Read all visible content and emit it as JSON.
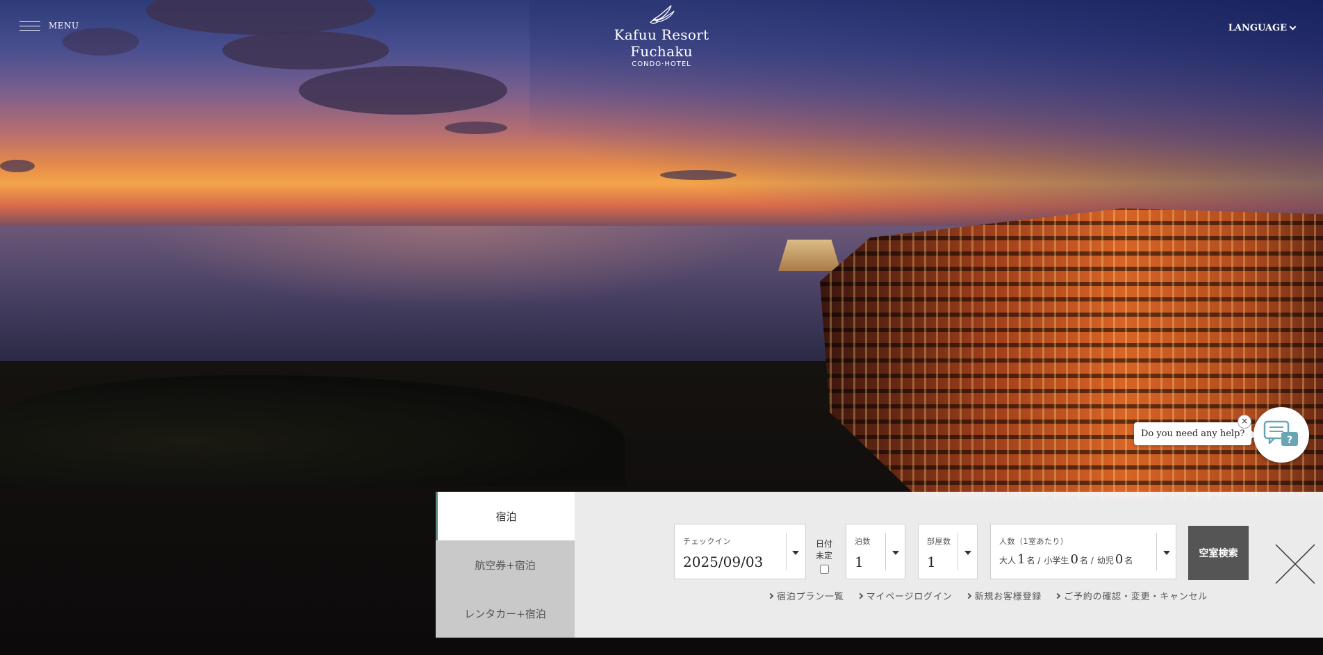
{
  "header": {
    "menu_label": "MENU",
    "logo_name": "Kafuu Resort Fuchaku",
    "logo_sub": "CONDO·HOTEL",
    "language_label": "LANGUAGE"
  },
  "chat": {
    "prompt": "Do you need any help?",
    "close_glyph": "×"
  },
  "booking": {
    "tabs": [
      {
        "label": "宿泊",
        "active": true
      },
      {
        "label": "航空券+宿泊",
        "active": false
      },
      {
        "label": "レンタカー+宿泊",
        "active": false
      }
    ],
    "checkin": {
      "label": "チェックイン",
      "value": "2025/09/03"
    },
    "undecided": {
      "line1": "日付",
      "line2": "未定",
      "checked": false
    },
    "nights": {
      "label": "泊数",
      "value": "1"
    },
    "rooms": {
      "label": "部屋数",
      "value": "1"
    },
    "people": {
      "label": "人数（1室あたり）",
      "adult_label": "大人",
      "adult_value": "1",
      "adult_unit": "名 /",
      "child_label": "小学生",
      "child_value": "0",
      "child_unit": "名 /",
      "infant_label": "幼児",
      "infant_value": "0",
      "infant_unit": "名"
    },
    "search_label": "空室検索",
    "links": [
      "宿泊プラン一覧",
      "マイページログイン",
      "新規お客様登録",
      "ご予約の確認・変更・キャンセル"
    ]
  },
  "colors": {
    "tab_inactive": "#c9c9c9",
    "tab_active": "#ffffff",
    "search_button": "#555555",
    "accent_chat": "#6aa5b3"
  }
}
